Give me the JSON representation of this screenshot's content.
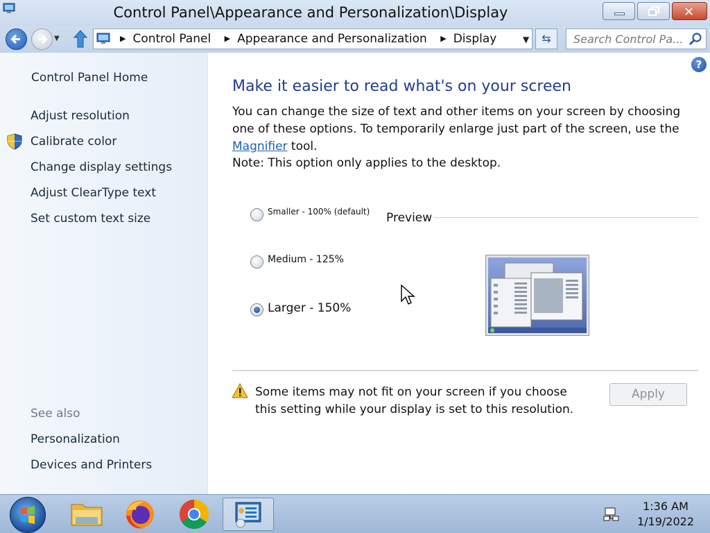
{
  "window": {
    "title": "Control Panel\\Appearance and Personalization\\Display"
  },
  "address_bar": {
    "crumbs": [
      "Control Panel",
      "Appearance and Personalization",
      "Display"
    ],
    "search_placeholder": "Search Control Pa..."
  },
  "sidebar": {
    "home": "Control Panel Home",
    "items": [
      {
        "label": "Adjust resolution",
        "icon": null
      },
      {
        "label": "Calibrate color",
        "icon": "shield-icon"
      },
      {
        "label": "Change display settings",
        "icon": null
      },
      {
        "label": "Adjust ClearType text",
        "icon": null
      },
      {
        "label": "Set custom text size",
        "icon": null
      }
    ],
    "see_also_label": "See also",
    "see_also": [
      "Personalization",
      "Devices and Printers"
    ]
  },
  "main": {
    "heading": "Make it easier to read what's on your screen",
    "description_before": "You can change the size of text and other items on your screen by choosing one of these options. To temporarily enlarge just part of the screen, use the ",
    "magnifier_link": "Magnifier",
    "description_after": " tool.",
    "note": "Note: This option only applies to the desktop.",
    "options": [
      {
        "label": "Smaller - 100% (default)",
        "checked": false
      },
      {
        "label": "Medium - 125%",
        "checked": false
      },
      {
        "label": "Larger - 150%",
        "checked": true
      }
    ],
    "preview_label": "Preview",
    "warning": "Some items may not fit on your screen if you choose this setting while your display is set to this resolution.",
    "apply_label": "Apply"
  },
  "taskbar": {
    "time": "1:36 AM",
    "date": "1/19/2022"
  },
  "colors": {
    "heading": "#1e3f8a",
    "link": "#1a5fb4",
    "sidebar_bg": "#eef3f9"
  }
}
